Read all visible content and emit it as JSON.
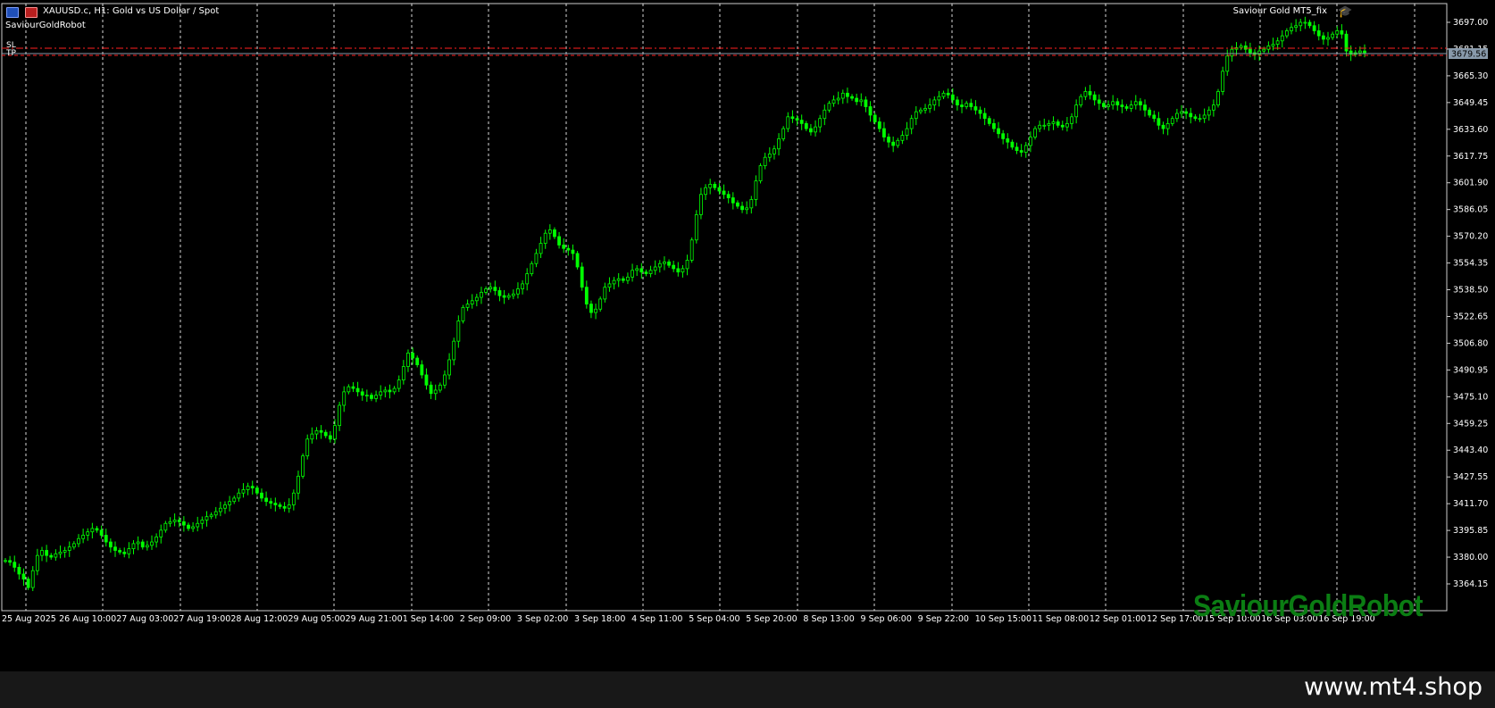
{
  "header": {
    "symbol_title": "XAUUSD.c, H1:  Gold vs US Dollar / Spot",
    "robot_name": "SaviourGoldRobot",
    "ea_name": "Saviour Gold MT5_fix",
    "icons": [
      "chart-window-icon",
      "chart-window-icon",
      "graduation-cap-icon"
    ]
  },
  "levels": {
    "sl_label": "SL",
    "tp_label": "TP",
    "current_price": "3679.56"
  },
  "watermark": "SaviourGoldRobot",
  "footer": {
    "url": "www.mt4.shop"
  },
  "colors": {
    "background": "#000000",
    "candle": "#00ff00",
    "grid": "#ffffff",
    "level_line": "#ff2020",
    "price_line": "#8899aa",
    "watermark": "#0b7d13"
  },
  "chart_data": {
    "type": "line",
    "chart_style": "candlestick",
    "timeframe": "H1",
    "grid": true,
    "y_axis_position": "right",
    "y_ticks": [
      "3697.00",
      "3681.15",
      "3665.30",
      "3649.45",
      "3633.60",
      "3617.75",
      "3601.90",
      "3586.05",
      "3570.20",
      "3554.35",
      "3538.50",
      "3522.65",
      "3506.80",
      "3490.95",
      "3475.10",
      "3459.25",
      "3443.40",
      "3427.55",
      "3411.70",
      "3395.85",
      "3380.00",
      "3364.15"
    ],
    "x_ticks": [
      "25 Aug 2025",
      "26 Aug 10:00",
      "27 Aug 03:00",
      "27 Aug 19:00",
      "28 Aug 12:00",
      "29 Aug 05:00",
      "29 Aug 21:00",
      "1 Sep 14:00",
      "2 Sep 09:00",
      "3 Sep 02:00",
      "3 Sep 18:00",
      "4 Sep 11:00",
      "5 Sep 04:00",
      "5 Sep 20:00",
      "8 Sep 13:00",
      "9 Sep 06:00",
      "9 Sep 22:00",
      "10 Sep 15:00",
      "11 Sep 08:00",
      "12 Sep 01:00",
      "12 Sep 17:00",
      "15 Sep 10:00",
      "16 Sep 03:00",
      "16 Sep 19:00"
    ],
    "series": [
      {
        "values": [
          3378,
          3377,
          3374,
          3370,
          3367,
          3362,
          3372,
          3381,
          3384,
          3381,
          3380,
          3382,
          3383,
          3384,
          3386,
          3388,
          3391,
          3393,
          3395,
          3397,
          3396,
          3393,
          3389,
          3386,
          3384,
          3383,
          3382,
          3385,
          3388,
          3389,
          3386,
          3387,
          3389,
          3392,
          3396,
          3400,
          3401,
          3402,
          3401,
          3399,
          3397,
          3398,
          3400,
          3402,
          3404,
          3405,
          3407,
          3409,
          3411,
          3413,
          3415,
          3418,
          3420,
          3422,
          3421,
          3418,
          3415,
          3413,
          3412,
          3411,
          3410,
          3409,
          3411,
          3418,
          3428,
          3440,
          3450,
          3453,
          3455,
          3454,
          3452,
          3450,
          3458,
          3470,
          3478,
          3481,
          3480,
          3478,
          3476,
          3476,
          3474,
          3476,
          3478,
          3479,
          3478,
          3480,
          3485,
          3493,
          3501,
          3498,
          3494,
          3488,
          3482,
          3477,
          3479,
          3482,
          3488,
          3497,
          3508,
          3520,
          3528,
          3530,
          3532,
          3534,
          3537,
          3539,
          3540,
          3538,
          3535,
          3534,
          3535,
          3536,
          3539,
          3542,
          3548,
          3554,
          3560,
          3566,
          3572,
          3574,
          3570,
          3565,
          3563,
          3562,
          3560,
          3552,
          3540,
          3530,
          3525,
          3527,
          3533,
          3540,
          3542,
          3544,
          3545,
          3544,
          3546,
          3550,
          3551,
          3549,
          3548,
          3550,
          3552,
          3554,
          3555,
          3553,
          3551,
          3549,
          3551,
          3556,
          3568,
          3583,
          3595,
          3599,
          3601,
          3599,
          3597,
          3595,
          3593,
          3590,
          3588,
          3586,
          3587,
          3592,
          3603,
          3612,
          3617,
          3619,
          3622,
          3628,
          3634,
          3641,
          3640,
          3639,
          3637,
          3634,
          3632,
          3635,
          3640,
          3645,
          3649,
          3651,
          3652,
          3655,
          3653,
          3652,
          3650,
          3651,
          3647,
          3642,
          3638,
          3634,
          3629,
          3626,
          3624,
          3627,
          3630,
          3634,
          3640,
          3644,
          3645,
          3646,
          3648,
          3651,
          3653,
          3655,
          3654,
          3651,
          3648,
          3647,
          3649,
          3647,
          3645,
          3643,
          3640,
          3637,
          3634,
          3631,
          3628,
          3626,
          3623,
          3621,
          3620,
          3624,
          3629,
          3634,
          3636,
          3636,
          3637,
          3638,
          3636,
          3635,
          3637,
          3641,
          3648,
          3653,
          3656,
          3654,
          3651,
          3649,
          3647,
          3648,
          3650,
          3648,
          3647,
          3646,
          3648,
          3650,
          3648,
          3645,
          3642,
          3640,
          3636,
          3634,
          3637,
          3640,
          3643,
          3644,
          3643,
          3641,
          3640,
          3640,
          3642,
          3645,
          3648,
          3656,
          3668,
          3677,
          3681,
          3682,
          3683,
          3681,
          3679,
          3678,
          3680,
          3681,
          3683,
          3684,
          3686,
          3689,
          3692,
          3694,
          3695,
          3697,
          3697,
          3695,
          3692,
          3689,
          3687,
          3688,
          3690,
          3692,
          3690,
          3680,
          3678,
          3679,
          3680,
          3679
        ]
      }
    ]
  }
}
